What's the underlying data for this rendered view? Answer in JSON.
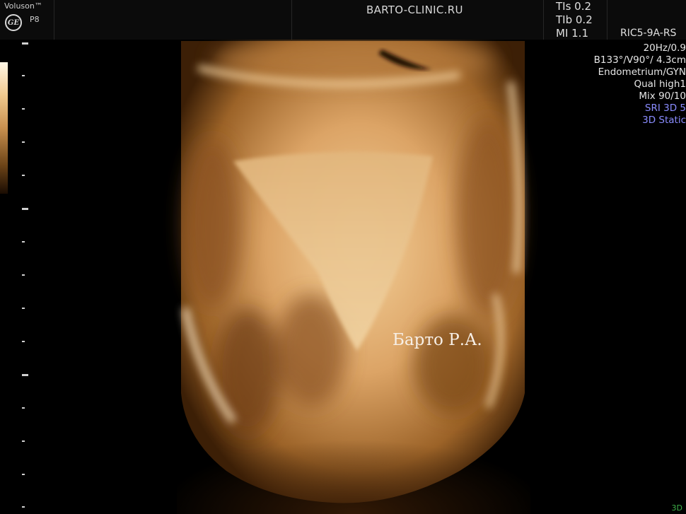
{
  "header": {
    "brand": "Voluson™",
    "logo": "GE",
    "model": "P8",
    "clinic": "BARTO-CLINIC.RU",
    "index": [
      "TIs 0.2",
      "TIb 0.2",
      "MI 1.1"
    ],
    "probe": "RIC5-9A-RS"
  },
  "info": {
    "lines": [
      "20Hz/0.9",
      "B133°/V90°/ 4.3cm",
      "Endometrium/GYN",
      "Qual high1",
      "Mix 90/10"
    ],
    "blue_lines": [
      "SRI 3D 5",
      "3D Static"
    ]
  },
  "watermark": "Барто Р.А.",
  "mode": "3D",
  "colors": {
    "background": "#000000",
    "tissue": "#e3ac6c",
    "highlight": "#f5d6a8",
    "shadow": "#5a3210",
    "info_blue": "#8a8cff",
    "mode_green": "#3fb24a"
  }
}
